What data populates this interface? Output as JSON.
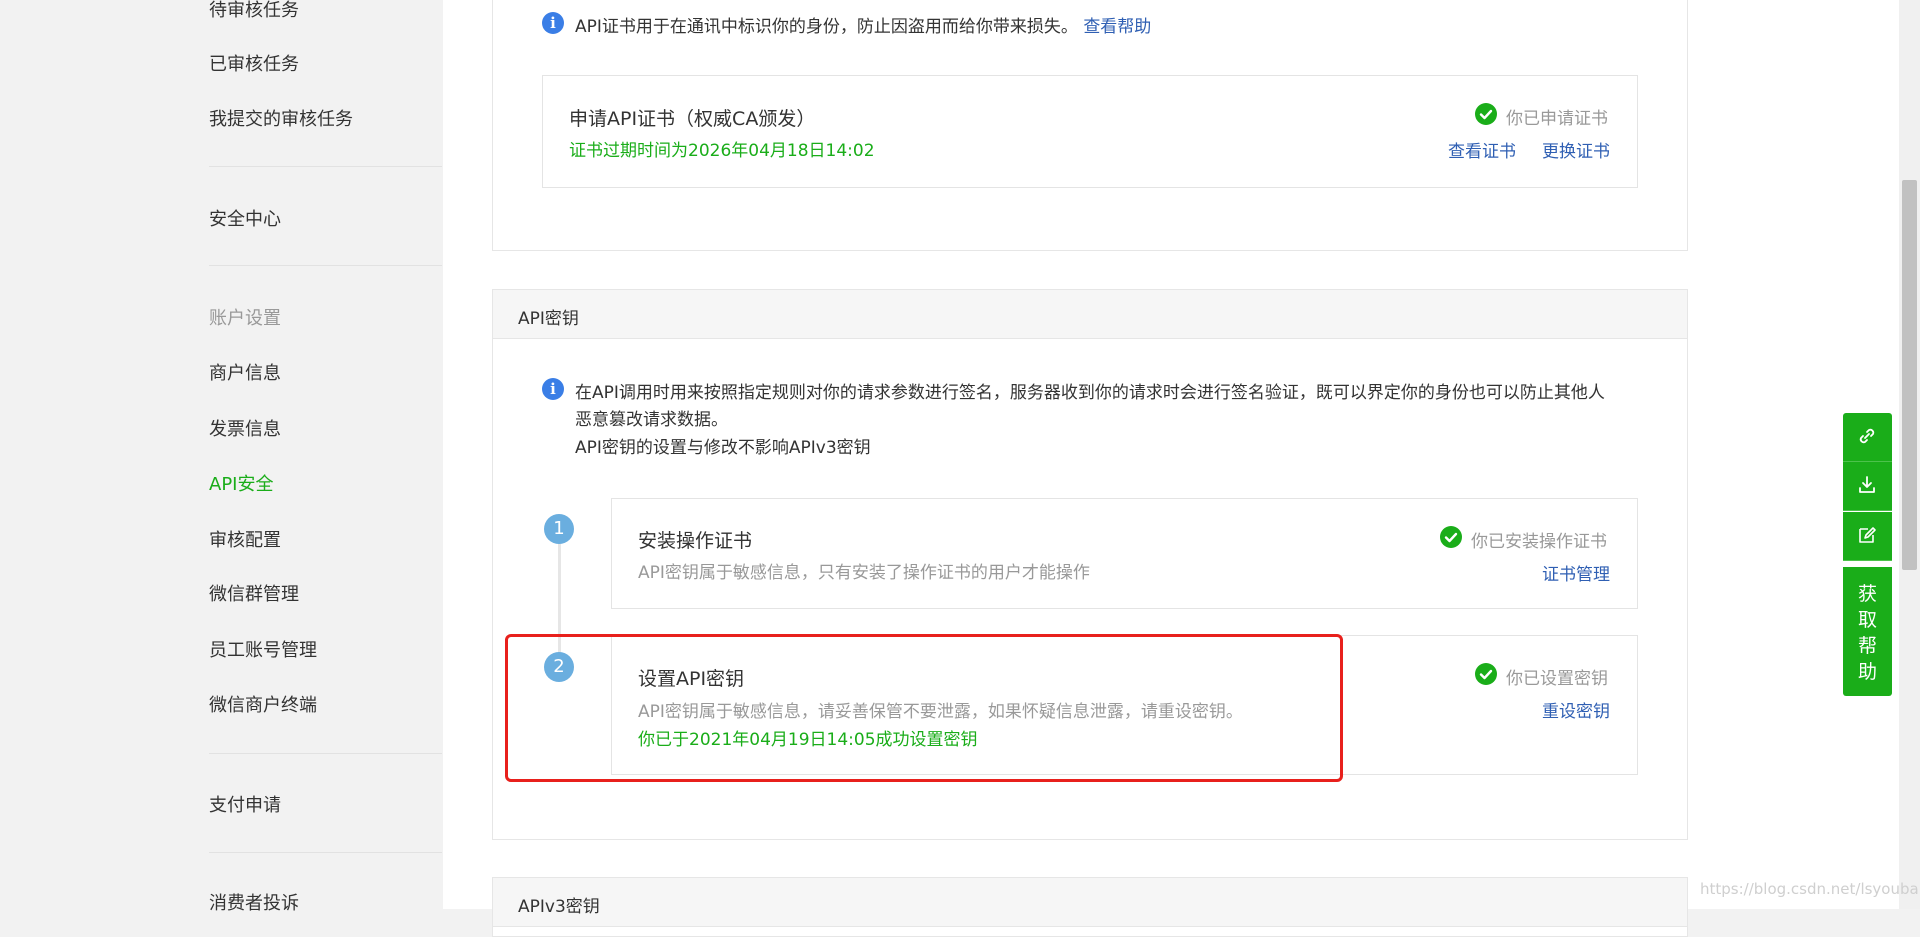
{
  "sidebar": {
    "items": [
      {
        "label": "待审核任务"
      },
      {
        "label": "已审核任务"
      },
      {
        "label": "我提交的审核任务"
      },
      {
        "label": "安全中心"
      },
      {
        "label": "账户设置"
      },
      {
        "label": "商户信息"
      },
      {
        "label": "发票信息"
      },
      {
        "label": "API安全"
      },
      {
        "label": "审核配置"
      },
      {
        "label": "微信群管理"
      },
      {
        "label": "员工账号管理"
      },
      {
        "label": "微信商户终端"
      },
      {
        "label": "支付申请"
      },
      {
        "label": "消费者投诉"
      }
    ],
    "active": "API安全"
  },
  "cert_section": {
    "notice": "API证书用于在通讯中标识你的身份，防止因盗用而给你带来损失。",
    "help_link": "查看帮助",
    "title": "申请API证书（权威CA颁发）",
    "expiry": "证书过期时间为2026年04月18日14:02",
    "status": "你已申请证书",
    "view_link": "查看证书",
    "replace_link": "更换证书"
  },
  "key_section": {
    "header": "API密钥",
    "notice_line1": "在API调用时用来按照指定规则对你的请求参数进行签名，服务器收到你的请求时会进行签名验证，既可以界定你的身份也可以防止其他人",
    "notice_line2": "恶意篡改请求数据。",
    "notice_line3": "API密钥的设置与修改不影响APIv3密钥",
    "steps": [
      {
        "num": "1",
        "title": "安装操作证书",
        "desc": "API密钥属于敏感信息，只有安装了操作证书的用户才能操作",
        "status": "你已安装操作证书",
        "action": "证书管理"
      },
      {
        "num": "2",
        "title": "设置API密钥",
        "desc": "API密钥属于敏感信息，请妥善保管不要泄露，如果怀疑信息泄露，请重设密钥。",
        "success": "你已于2021年04月19日14:05成功设置密钥",
        "status": "你已设置密钥",
        "action": "重设密钥"
      }
    ]
  },
  "v3_section": {
    "header": "APIv3密钥"
  },
  "float_bar": {
    "icons": [
      "link-icon",
      "download-icon",
      "edit-icon"
    ],
    "help_chars": [
      "获",
      "取",
      "帮",
      "助"
    ]
  },
  "watermark": "https://blog.csdn.net/lsyoubai",
  "colors": {
    "accent": "#1aad19",
    "link": "#2f5fb3",
    "highlight": "#e8201c",
    "info": "#3a7ee6"
  }
}
